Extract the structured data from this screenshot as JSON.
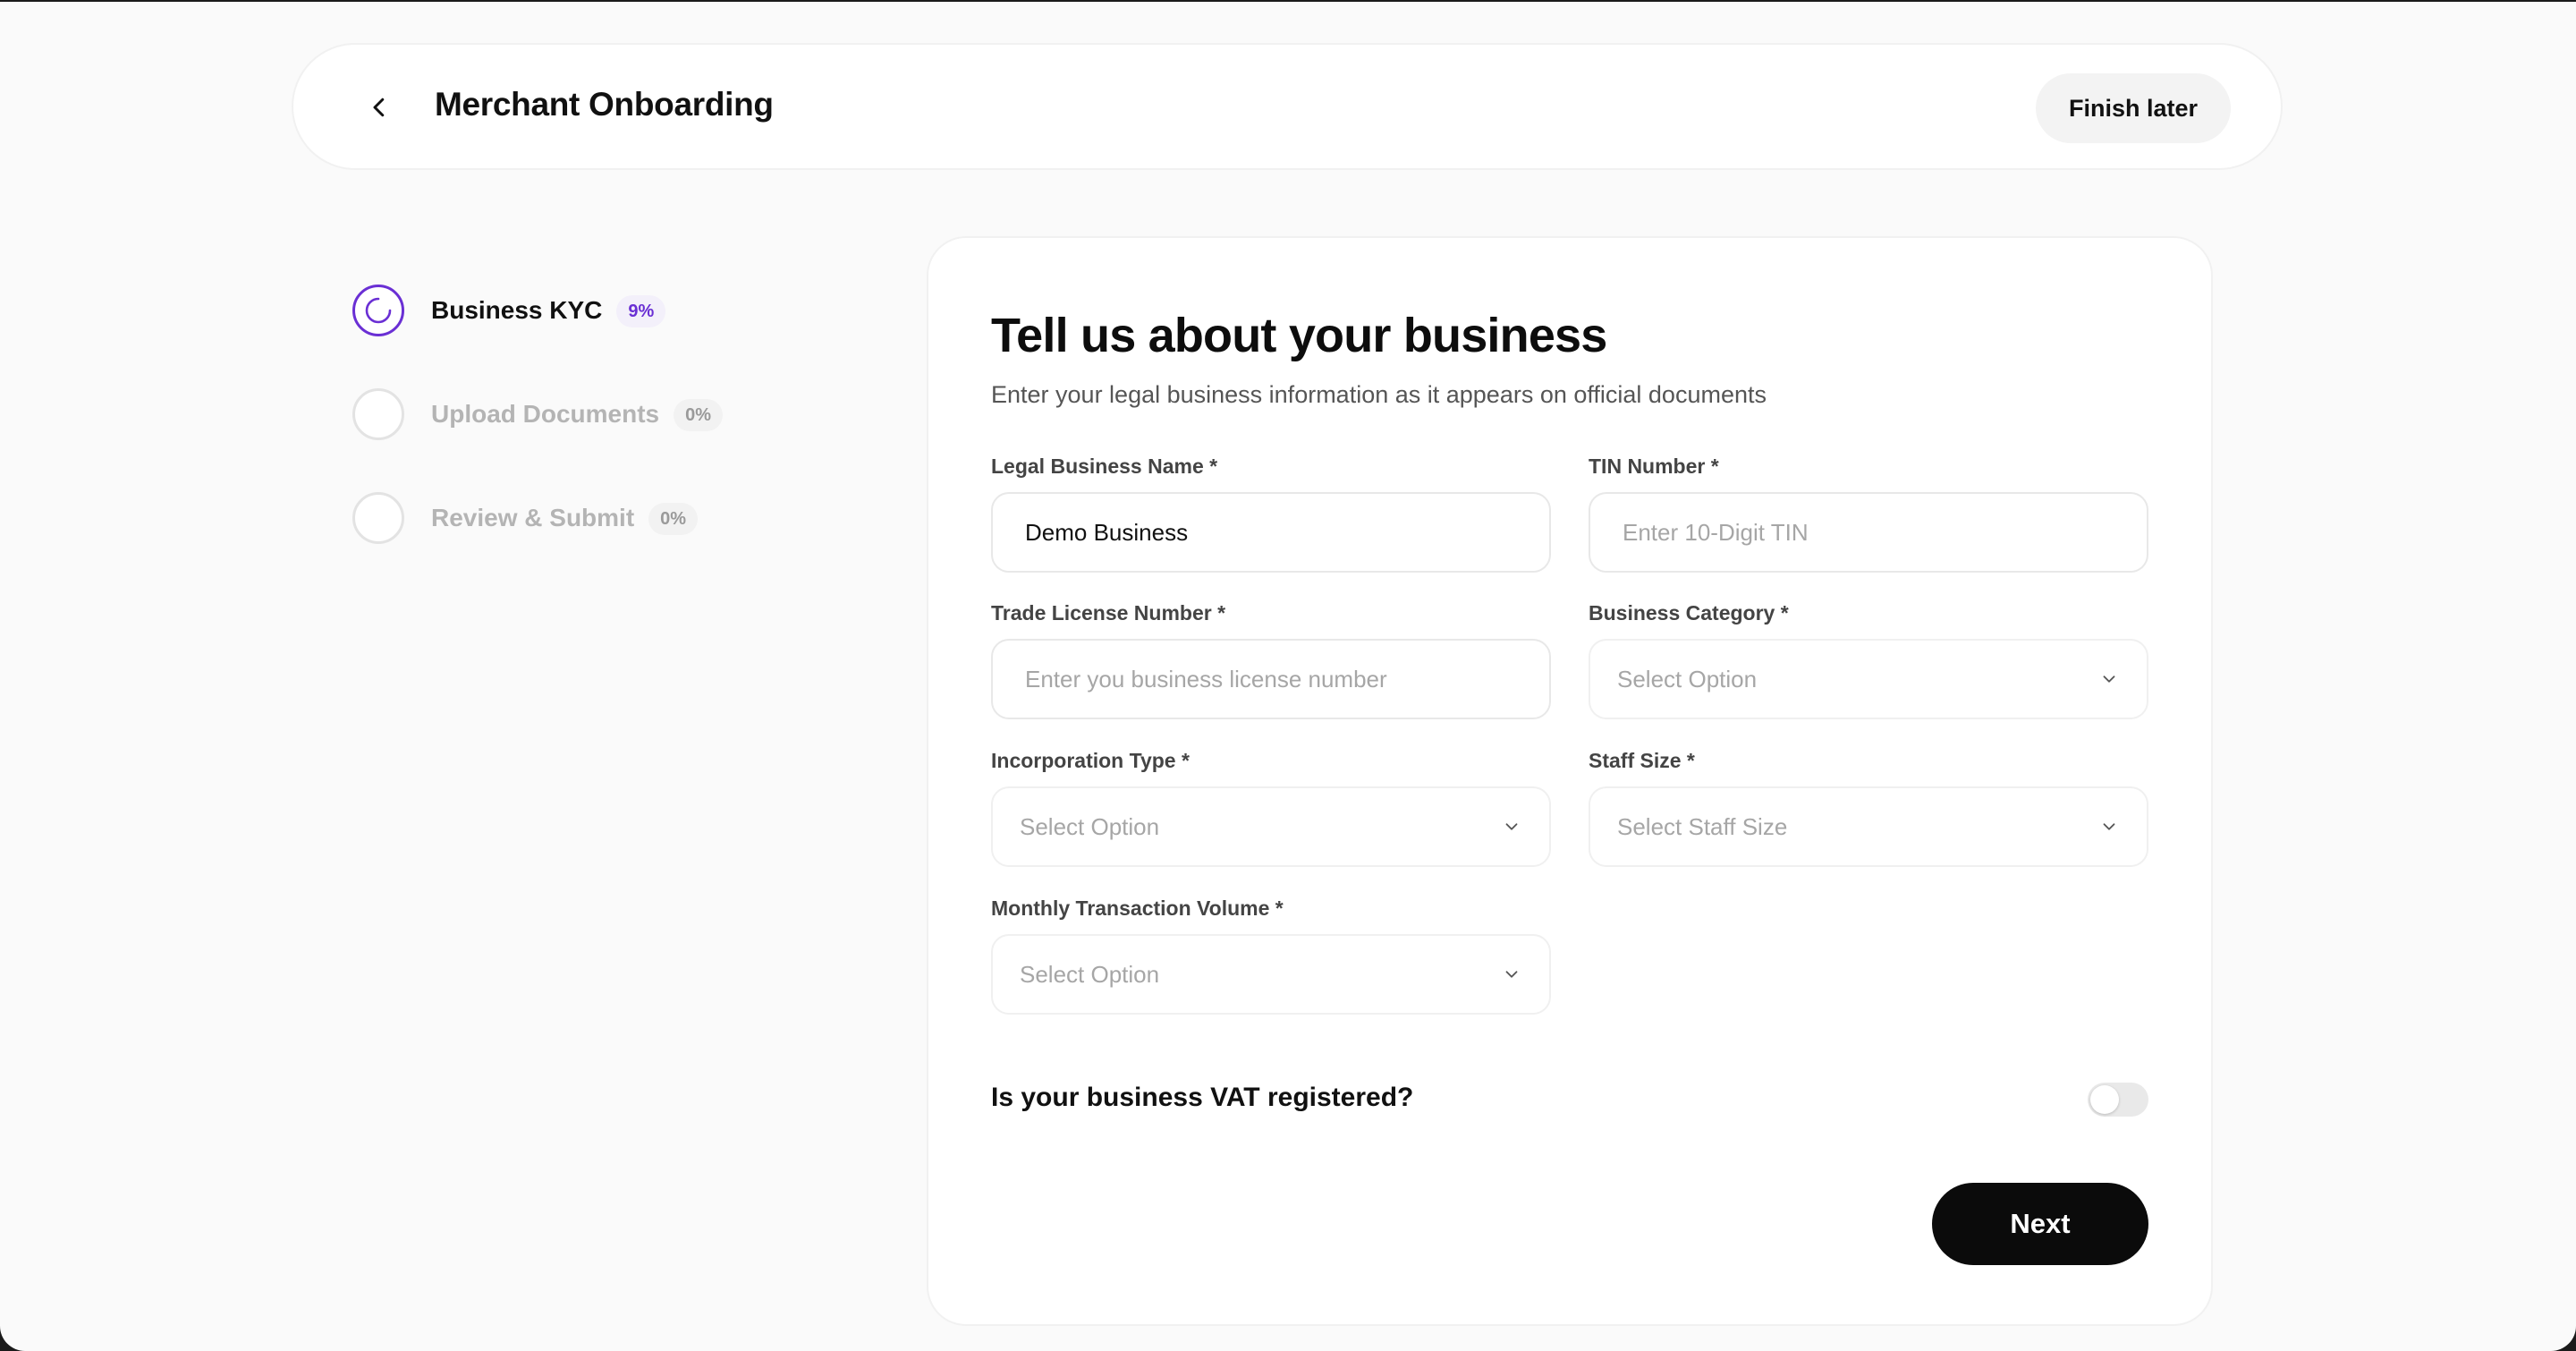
{
  "header": {
    "title": "Merchant Onboarding",
    "finish_later_label": "Finish later",
    "back_icon": "chevron-left-icon"
  },
  "steps": [
    {
      "label": "Business KYC",
      "progress": "9%",
      "active": true
    },
    {
      "label": "Upload Documents",
      "progress": "0%",
      "active": false
    },
    {
      "label": "Review & Submit",
      "progress": "0%",
      "active": false
    }
  ],
  "form": {
    "title": "Tell us about your business",
    "subtitle": "Enter your legal business information as it appears on official documents",
    "legal_name": {
      "label": "Legal Business Name *",
      "value": "Demo Business",
      "placeholder": ""
    },
    "tin": {
      "label": "TIN Number *",
      "value": "",
      "placeholder": "Enter 10-Digit TIN"
    },
    "trade_license": {
      "label": "Trade License Number *",
      "value": "",
      "placeholder": "Enter you business license number"
    },
    "business_category": {
      "label": "Business Category *",
      "selected": "Select Option"
    },
    "incorporation_type": {
      "label": "Incorporation Type *",
      "selected": "Select Option"
    },
    "staff_size": {
      "label": "Staff Size *",
      "selected": "Select Staff Size"
    },
    "monthly_volume": {
      "label": "Monthly Transaction Volume *",
      "selected": "Select Option"
    },
    "vat_question": "Is your business VAT registered?",
    "vat_registered": false,
    "next_label": "Next"
  },
  "colors": {
    "accent": "#6a2fd4",
    "primary_button": "#0b0b0b",
    "background": "#fafafa"
  }
}
